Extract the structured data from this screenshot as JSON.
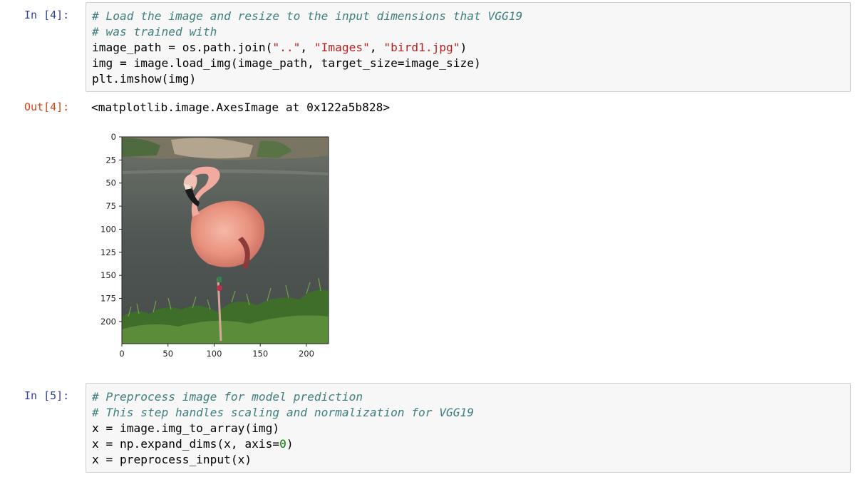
{
  "cells": [
    {
      "prompt": "In [4]:",
      "lines": [
        [
          {
            "t": "cm",
            "v": "# Load the image and resize to the input dimensions that VGG19"
          }
        ],
        [
          {
            "t": "cm",
            "v": "# was trained with"
          }
        ],
        [
          {
            "t": "",
            "v": "image_path = os.path.join("
          },
          {
            "t": "str",
            "v": "\"..\""
          },
          {
            "t": "",
            "v": ", "
          },
          {
            "t": "str",
            "v": "\"Images\""
          },
          {
            "t": "",
            "v": ", "
          },
          {
            "t": "str",
            "v": "\"bird1.jpg\""
          },
          {
            "t": "",
            "v": ")"
          }
        ],
        [
          {
            "t": "",
            "v": "img = image.load_img(image_path, target_size=image_size)"
          }
        ],
        [
          {
            "t": "",
            "v": "plt.imshow(img)"
          }
        ]
      ]
    },
    {
      "prompt": "In [5]:",
      "lines": [
        [
          {
            "t": "cm",
            "v": "# Preprocess image for model prediction"
          }
        ],
        [
          {
            "t": "cm",
            "v": "# This step handles scaling and normalization for VGG19"
          }
        ],
        [
          {
            "t": "",
            "v": "x = image.img_to_array(img)"
          }
        ],
        [
          {
            "t": "",
            "v": "x = np.expand_dims(x, axis="
          },
          {
            "t": "num",
            "v": "0"
          },
          {
            "t": "",
            "v": ")"
          }
        ],
        [
          {
            "t": "",
            "v": "x = preprocess_input(x)"
          }
        ]
      ]
    }
  ],
  "output": {
    "prompt": "Out[4]:",
    "text": "<matplotlib.image.AxesImage at 0x122a5b828>"
  },
  "chart_data": {
    "type": "image",
    "xticks": [
      0,
      50,
      100,
      150,
      200
    ],
    "yticks": [
      0,
      25,
      50,
      75,
      100,
      125,
      150,
      175,
      200
    ],
    "xlim": [
      0,
      224
    ],
    "ylim": [
      224,
      0
    ],
    "image_content": "flamingo-photo"
  }
}
